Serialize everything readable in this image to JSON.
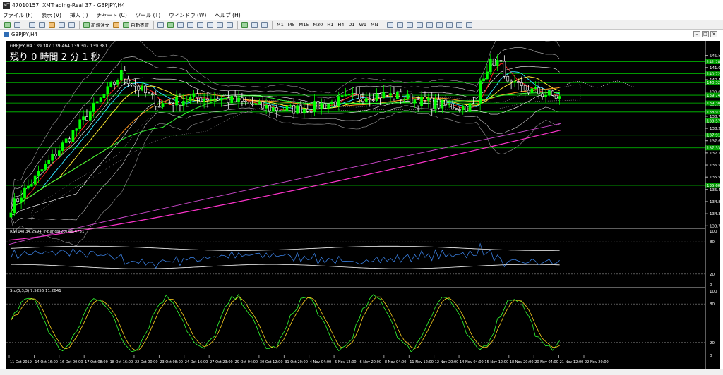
{
  "window": {
    "title": "47010157: XMTrading-Real 37 - GBPJPY,H4",
    "app_icon_label": "MT"
  },
  "menu": [
    "ファイル (F)",
    "表示 (V)",
    "挿入 (I)",
    "チャート (C)",
    "ツール (T)",
    "ウィンドウ (W)",
    "ヘルプ (H)"
  ],
  "toolbar": {
    "new_order": "新規注文",
    "auto_trade": "自動売買",
    "timeframes": [
      "M1",
      "M5",
      "M15",
      "M30",
      "H1",
      "H4",
      "D1",
      "W1",
      "MN"
    ]
  },
  "chart": {
    "tab_label": "GBPJPY,H4",
    "info_line": "GBPJPY,H4  139.387 139.464 139.307 139.381",
    "countdown": "残り 0 時間 2 分 1 秒",
    "colors": {
      "background": "#000000",
      "bull": "#00ff00",
      "bear": "#ffffff",
      "grid_line": "#00cc00",
      "sma_long": "#ff33cc",
      "price_label": "#00a000"
    },
    "price_axis": [
      "141.570",
      "141.015",
      "140.460",
      "139.890",
      "139.335",
      "138.780",
      "138.225",
      "137.655",
      "137.100",
      "136.545",
      "135.990",
      "135.420",
      "134.865",
      "134.310",
      "133.755"
    ],
    "level_labels": [
      "141.285",
      "140.729",
      "140.322",
      "139.745",
      "139.388",
      "138.977",
      "138.570",
      "137.914",
      "137.331",
      "135.607"
    ],
    "time_axis": [
      "11 Oct 2019",
      "14 Oct 16:00",
      "16 Oct 00:00",
      "17 Oct 08:00",
      "18 Oct 16:00",
      "22 Oct 00:00",
      "23 Oct 08:00",
      "24 Oct 16:00",
      "27 Oct 23:00",
      "29 Oct 04:00",
      "30 Oct 12:00",
      "31 Oct 20:00",
      "4 Nov 04:00",
      "5 Nov 12:00",
      "6 Nov 20:00",
      "8 Nov 04:00",
      "11 Nov 12:00",
      "12 Nov 20:00",
      "14 Nov 04:00",
      "15 Nov 12:00",
      "18 Nov 20:00",
      "20 Nov 04:00",
      "21 Nov 12:00",
      "22 Nov 20:00"
    ]
  },
  "rsi": {
    "label": "RSI(14) 34.2594  Tr-Bands(20) 46.4751",
    "levels": [
      "100",
      "80",
      "20",
      "0"
    ]
  },
  "stoch": {
    "label": "Sto(5,3,3) 7.5256 11.2641",
    "levels": [
      "100",
      "80",
      "20",
      "0"
    ]
  }
}
